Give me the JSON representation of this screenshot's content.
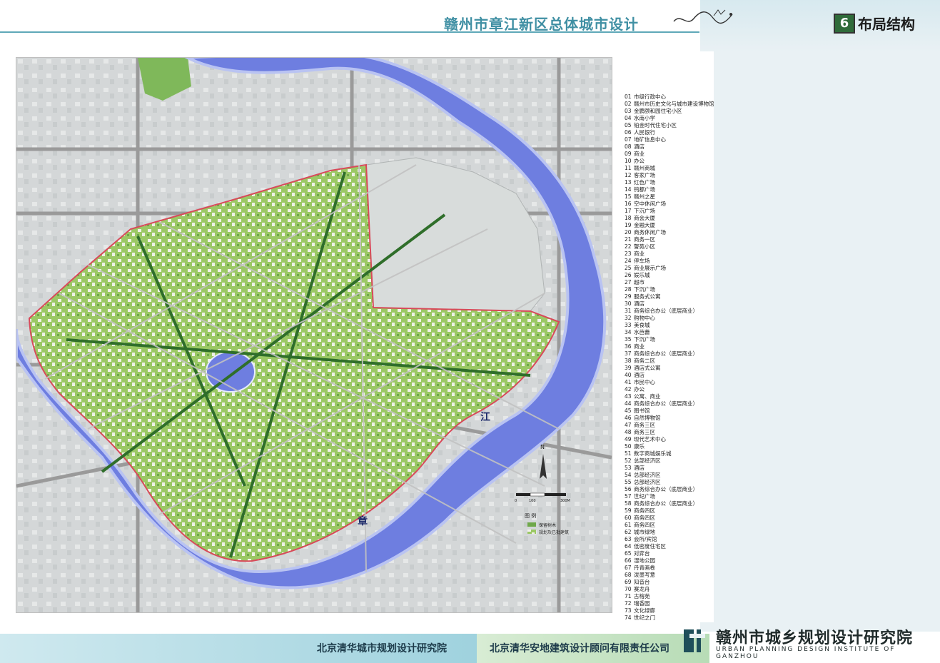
{
  "header": {
    "project_title": "赣州市章江新区总体城市设计",
    "section_number": "6",
    "section_title": "布局结构"
  },
  "map": {
    "river_labels": [
      "江",
      "章"
    ],
    "colors": {
      "river": "#6f7fe0",
      "river_edge": "#b9c3f2",
      "green_area": "#8fc15c",
      "urban_gray": "#cfd3d4",
      "road": "#8c8c8c",
      "boundary": "#d84a5a"
    },
    "north_arrow_label": "N",
    "scale_labels": [
      "0",
      "100",
      "300M"
    ],
    "legend_title": "图 例",
    "legend_items": [
      "保留树木",
      "规划及已批建筑"
    ]
  },
  "legend_list": [
    {
      "num": "01",
      "name": "市级行政中心"
    },
    {
      "num": "02",
      "name": "赣州市历史文化与城市建设博物馆"
    },
    {
      "num": "03",
      "name": "金鹏颐和园住宅小区"
    },
    {
      "num": "04",
      "name": "水南小学"
    },
    {
      "num": "05",
      "name": "铂金时代住宅小区"
    },
    {
      "num": "06",
      "name": "人民银行"
    },
    {
      "num": "07",
      "name": "地矿信息中心"
    },
    {
      "num": "08",
      "name": "酒店"
    },
    {
      "num": "09",
      "name": "商业"
    },
    {
      "num": "10",
      "name": "办公"
    },
    {
      "num": "11",
      "name": "赣州商城"
    },
    {
      "num": "12",
      "name": "客家广场"
    },
    {
      "num": "13",
      "name": "红色广场"
    },
    {
      "num": "14",
      "name": "钨都广场"
    },
    {
      "num": "15",
      "name": "赣州之星"
    },
    {
      "num": "16",
      "name": "空中休闲广场"
    },
    {
      "num": "17",
      "name": "下沉广场"
    },
    {
      "num": "18",
      "name": "商会大厦"
    },
    {
      "num": "19",
      "name": "金融大厦"
    },
    {
      "num": "20",
      "name": "商务休闲广场"
    },
    {
      "num": "21",
      "name": "商务一区"
    },
    {
      "num": "22",
      "name": "警苑小区"
    },
    {
      "num": "23",
      "name": "商业"
    },
    {
      "num": "24",
      "name": "停车场"
    },
    {
      "num": "25",
      "name": "商业展示广场"
    },
    {
      "num": "26",
      "name": "娱乐城"
    },
    {
      "num": "27",
      "name": "超市"
    },
    {
      "num": "28",
      "name": "下沉广场"
    },
    {
      "num": "29",
      "name": "服务式公寓"
    },
    {
      "num": "30",
      "name": "酒店"
    },
    {
      "num": "31",
      "name": "商务综合办公（底层商业）"
    },
    {
      "num": "32",
      "name": "购物中心"
    },
    {
      "num": "33",
      "name": "美食城"
    },
    {
      "num": "34",
      "name": "水芭蕾"
    },
    {
      "num": "35",
      "name": "下沉广场"
    },
    {
      "num": "36",
      "name": "商业"
    },
    {
      "num": "37",
      "name": "商务综合办公（底层商业）"
    },
    {
      "num": "38",
      "name": "商务二区"
    },
    {
      "num": "39",
      "name": "酒店式公寓"
    },
    {
      "num": "40",
      "name": "酒店"
    },
    {
      "num": "41",
      "name": "市民中心"
    },
    {
      "num": "42",
      "name": "办公"
    },
    {
      "num": "43",
      "name": "公寓、商业"
    },
    {
      "num": "44",
      "name": "商务综合办公（底层商业）"
    },
    {
      "num": "45",
      "name": "图书馆"
    },
    {
      "num": "46",
      "name": "自然博物馆"
    },
    {
      "num": "47",
      "name": "商务三区"
    },
    {
      "num": "48",
      "name": "商务三区"
    },
    {
      "num": "49",
      "name": "现代艺术中心"
    },
    {
      "num": "50",
      "name": "康乐"
    },
    {
      "num": "51",
      "name": "数字商城娱乐城"
    },
    {
      "num": "52",
      "name": "总部经济区"
    },
    {
      "num": "53",
      "name": "酒店"
    },
    {
      "num": "54",
      "name": "总部经济区"
    },
    {
      "num": "55",
      "name": "总部经济区"
    },
    {
      "num": "56",
      "name": "商务综合办公（底层商业）"
    },
    {
      "num": "57",
      "name": "世纪广场"
    },
    {
      "num": "58",
      "name": "商务综合办公（底层商业）"
    },
    {
      "num": "59",
      "name": "商务四区"
    },
    {
      "num": "60",
      "name": "商务四区"
    },
    {
      "num": "61",
      "name": "商务四区"
    },
    {
      "num": "62",
      "name": "城市绿地"
    },
    {
      "num": "63",
      "name": "会所/宾馆"
    },
    {
      "num": "64",
      "name": "低密度住宅区"
    },
    {
      "num": "65",
      "name": "对弈台"
    },
    {
      "num": "66",
      "name": "湿地公园"
    },
    {
      "num": "67",
      "name": "丹青画卷"
    },
    {
      "num": "68",
      "name": "泼墨写意"
    },
    {
      "num": "69",
      "name": "知音台"
    },
    {
      "num": "70",
      "name": "赛龙舟"
    },
    {
      "num": "71",
      "name": "古榕苑"
    },
    {
      "num": "72",
      "name": "瑞香园"
    },
    {
      "num": "73",
      "name": "文化绿廊"
    },
    {
      "num": "74",
      "name": "世纪之门"
    }
  ],
  "footer": {
    "org_1": "北京清华城市规划设计研究院",
    "org_2": "北京清华安地建筑设计顾问有限责任公司",
    "institute_cn": "赣州市城乡规划设计研究院",
    "institute_en": "URBAN PLANNING DESIGN INSTITUTE OF GANZHOU"
  }
}
